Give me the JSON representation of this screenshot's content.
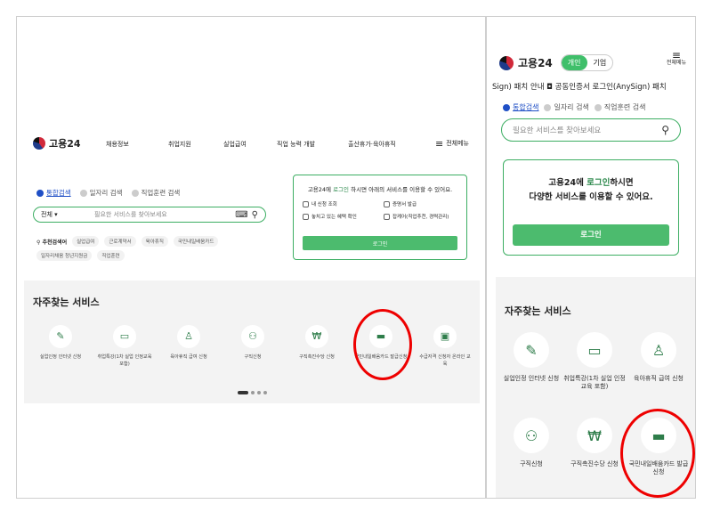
{
  "brand": "고용24",
  "desktop": {
    "nav": [
      "채용정보",
      "취업지원",
      "실업급여",
      "직업 능력 개발",
      "출산휴가·육아휴직"
    ],
    "menu_all": "전체메뉴",
    "search_tabs": [
      "통합검색",
      "일자리 검색",
      "직업훈련 검색"
    ],
    "search_scope": "전체",
    "search_placeholder": "필요한 서비스를 찾아보세요",
    "recommend_label": "추천검색어",
    "recommend_chips": [
      "실업급여",
      "근로계약서",
      "육아휴직",
      "국민내일배움카드",
      "일자리채움 청년지원금",
      "직업훈련"
    ],
    "login_text_pre": "고용24에 ",
    "login_text_link": "로그인",
    "login_text_post": " 하시면 아래의 서비스를 이용할 수 있어요.",
    "login_items": [
      "내 신청 조회",
      "증명서 발급",
      "놓치고 있는 혜택 확인",
      "잡케어(직업추천, 경력관리)"
    ],
    "login_button": "로그인",
    "services_title": "자주찾는 서비스",
    "services": [
      "실업인정 인터넷 신청",
      "취업특강(1차 실업 인정교육 포함)",
      "육아휴직 급여 신청",
      "구직신청",
      "구직촉진수당 신청",
      "국민내일배움카드 발급신청",
      "수급자격 신청자 온라인 교육"
    ]
  },
  "mobile": {
    "seg": [
      "개인",
      "기업"
    ],
    "menu_all": "전체메뉴",
    "ticker": "Sign) 패치 안내   ◘ 공동인증서 로그인(AnySign) 패치",
    "search_tabs": [
      "통합검색",
      "일자리 검색",
      "직업훈련 검색"
    ],
    "search_placeholder": "필요한 서비스를 찾아보세요",
    "login_line1_pre": "고용24에 ",
    "login_line1_link": "로그인",
    "login_line1_post": "하시면",
    "login_line2": "다양한 서비스를 이용할 수 있어요.",
    "login_button": "로그인",
    "services_title": "자주찾는 서비스",
    "services": [
      "실업인정 인터넷 신청",
      "취업특강(1차 실업 인정교육 포함)",
      "육아휴직 급여 신청",
      "구직신청",
      "구직촉진수당 신청",
      "국민내일배움카드 발급신청"
    ]
  }
}
